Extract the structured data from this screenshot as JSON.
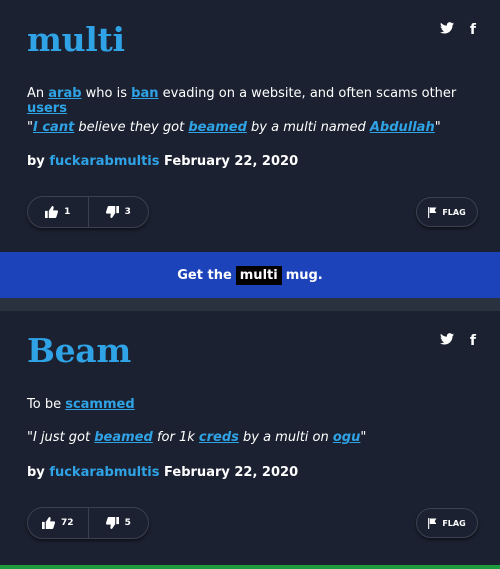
{
  "entries": [
    {
      "word": "multi",
      "meaning": {
        "t1": "An ",
        "l1": "arab",
        "t2": " who is ",
        "l2": "ban",
        "t3": " evading on a website, and often scams other ",
        "l3": "users"
      },
      "example": {
        "t1": "\"",
        "l1": "I cant",
        "t2": " believe they got ",
        "l2": "beamed",
        "t3": " by a multi named ",
        "l3": "Abdullah",
        "t4": "\""
      },
      "by": "by ",
      "author": "fuckarabmultis",
      "date": "February 22, 2020",
      "upvotes": "1",
      "downvotes": "3",
      "flag": "FLAG"
    },
    {
      "word": "Beam",
      "meaning": {
        "t1": "To be ",
        "l1": "scammed"
      },
      "example": {
        "t1": "\"I just got ",
        "l1": "beamed",
        "t2": " for 1k ",
        "l2": "creds",
        "t3": " by a multi on ",
        "l3": "ogu",
        "t4": "\""
      },
      "by": "by ",
      "author": "fuckarabmultis",
      "date": "February 22, 2020",
      "upvotes": "72",
      "downvotes": "5",
      "flag": "FLAG"
    }
  ],
  "mug": {
    "before": "Get the",
    "word": "multi",
    "after": "mug."
  },
  "share": {
    "twitter_icon": "twitter-icon",
    "facebook_icon": "facebook-icon",
    "facebook_glyph": "f"
  },
  "colors": {
    "background": "#2a3240",
    "card": "#1b2130",
    "accent": "#2fa3e6",
    "mug_banner": "#1d43ba",
    "green_banner": "#1e9b3c"
  }
}
